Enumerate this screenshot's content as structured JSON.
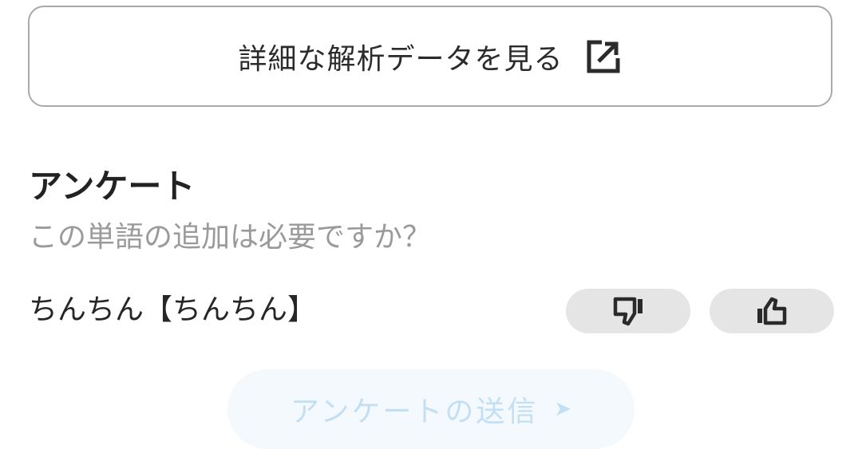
{
  "details_button": {
    "label": "詳細な解析データを見る",
    "icon": "external-link-icon"
  },
  "survey": {
    "title": "アンケート",
    "question": "この単語の追加は必要ですか？",
    "word": "ちんちん【ちんちん】",
    "dislike_icon": "thumbs-down-icon",
    "like_icon": "thumbs-up-icon"
  },
  "submit": {
    "label": "アンケートの送信",
    "arrow": "➤",
    "state": "disabled"
  },
  "colors": {
    "border": "#a9a9a9",
    "vote_bg": "#e5e5e5",
    "submit_bg": "#f4f9fd",
    "submit_text": "#c3dff4",
    "muted_text": "#9a9a9a"
  }
}
